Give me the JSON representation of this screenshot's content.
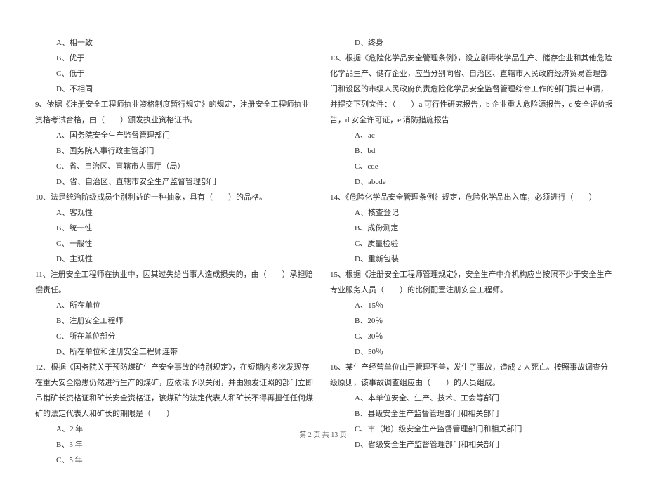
{
  "left_column": {
    "q8_options": [
      "A、相一致",
      "B、优于",
      "C、低于",
      "D、不相同"
    ],
    "q9": {
      "text": "9、依据《注册安全工程师执业资格制度暂行规定》的规定，注册安全工程师执业资格考试合格，由（　　）颁发执业资格证书。",
      "options": [
        "A、国务院安全生产监督管理部门",
        "B、国务院人事行政主管部门",
        "C、省、自治区、直辖市人事厅（局）",
        "D、省、自治区、直辖市安全生产监督管理部门"
      ]
    },
    "q10": {
      "text": "10、法是统治阶级成员个别利益的一种抽象，具有（　　）的品格。",
      "options": [
        "A、客观性",
        "B、统一性",
        "C、一般性",
        "D、主观性"
      ]
    },
    "q11": {
      "text": "11、注册安全工程师在执业中，因其过失给当事人造成损失的，由（　　）承担赔偿责任。",
      "options": [
        "A、所在单位",
        "B、注册安全工程师",
        "C、所在单位部分",
        "D、所在单位和注册安全工程师连带"
      ]
    },
    "q12": {
      "text": "12、根据《国务院关于预防煤矿生产安全事故的特别规定》，在短期内多次发现存在重大安全隐患仍然进行生产的煤矿，应依法予以关闭，并由颁发证照的部门立即吊销矿长资格证和矿长安全资格证，该煤矿的法定代表人和矿长不得再担任任何煤矿的法定代表人和矿长的期限是（　　）",
      "options": [
        "A、2 年",
        "B、3 年",
        "C、5 年"
      ]
    }
  },
  "right_column": {
    "q12_option_d": "D、终身",
    "q13": {
      "text": "13、根据《危险化学品安全管理条例》，设立剧毒化学品生产、储存企业和其他危险化学品生产、储存企业，应当分别向省、自治区、直辖市人民政府经济贸易管理部门和设区的市级人民政府负责危险化学品安全监督管理综合工作的部门提出申请，并提交下列文件：（　　）a 可行性研究报告，b 企业重大危险源报告，c 安全评价报告，d 安全许可证，e 消防措施报告",
      "options": [
        "A、ac",
        "B、bd",
        "C、cde",
        "D、abcde"
      ]
    },
    "q14": {
      "text": "14、《危险化学品安全管理条例》规定，危险化学品出入库，必须进行（　　）",
      "options": [
        "A、核查登记",
        "B、成份测定",
        "C、质量检验",
        "D、重新包装"
      ]
    },
    "q15": {
      "text": "15、根据《注册安全工程师管理规定》，安全生产中介机构应当按照不少于安全生产专业服务人员（　　）的比例配置注册安全工程师。",
      "options": [
        "A、15％",
        "B、20％",
        "C、30％",
        "D、50％"
      ]
    },
    "q16": {
      "text": "16、某生产经营单位由于管理不善，发生了事故，造成 2 人死亡。按照事故调查分级原则，该事故调查组应由（　　）的人员组成。",
      "options": [
        "A、本单位安全、生产、技术、工会等部门",
        "B、县级安全生产监督管理部门和相关部门",
        "C、市（地）级安全生产监督管理部门和相关部门",
        "D、省级安全生产监督管理部门和相关部门"
      ]
    }
  },
  "footer": "第 2 页 共 13 页"
}
